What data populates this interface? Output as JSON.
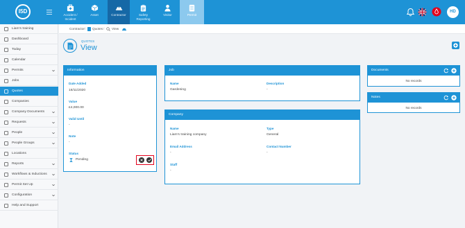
{
  "topbar": {
    "logo_text": "I5D",
    "nav": [
      {
        "label1": "Accident /",
        "label2": "Incident",
        "icon": "first-aid-icon"
      },
      {
        "label1": "Asset",
        "label2": "",
        "icon": "asset-box-icon"
      },
      {
        "label1": "Contractor",
        "label2": "",
        "icon": "hard-hat-icon"
      },
      {
        "label1": "Safety",
        "label2": "Reporting",
        "icon": "clipboard-icon"
      },
      {
        "label1": "Visitor",
        "label2": "",
        "icon": "person-icon"
      },
      {
        "label1": "Permit",
        "label2": "",
        "icon": "permit-icon"
      }
    ],
    "avatar_initials": "HD"
  },
  "sidebar": {
    "items": [
      {
        "label": "Liam's training",
        "icon": "swap-icon"
      },
      {
        "label": "Dashboard",
        "icon": "dashboard-icon"
      },
      {
        "label": "Today",
        "icon": "calendar-today-icon"
      },
      {
        "label": "Calendar",
        "icon": "calendar-icon"
      },
      {
        "label": "Permits",
        "icon": "folder-icon",
        "chevron": true
      },
      {
        "label": "Jobs",
        "icon": "document-icon"
      },
      {
        "label": "Quotes",
        "icon": "document-icon"
      },
      {
        "label": "Companies",
        "icon": "building-icon"
      },
      {
        "label": "Company Documents",
        "icon": "documents-icon",
        "chevron": true
      },
      {
        "label": "Requests",
        "icon": "inbox-icon",
        "chevron": true
      },
      {
        "label": "People",
        "icon": "people-icon",
        "chevron": true
      },
      {
        "label": "People Groups",
        "icon": "people-group-icon",
        "chevron": true
      },
      {
        "label": "Locations",
        "icon": "location-icon"
      },
      {
        "label": "Reports",
        "icon": "reports-icon",
        "chevron": true
      },
      {
        "label": "Workflows & Inductions",
        "icon": "workflow-icon",
        "chevron": true
      },
      {
        "label": "Permit Set Up",
        "icon": "setup-icon",
        "chevron": true
      },
      {
        "label": "Configuration",
        "icon": "gear-icon",
        "chevron": true
      },
      {
        "label": "Help and Support",
        "icon": "help-icon"
      }
    ],
    "active_index": 6
  },
  "breadcrumb": {
    "items": [
      "Contractor",
      "Quotes",
      "View"
    ]
  },
  "page": {
    "subtitle": "QUOTES",
    "title": "View"
  },
  "information": {
    "header": "Information",
    "date_added_label": "Date Added",
    "date_added_value": "16/11/2020",
    "value_label": "Value",
    "value_value": "£4,000.00",
    "valid_until_label": "Valid Until",
    "valid_until_value": "-",
    "note_label": "Note",
    "note_value": "-",
    "status_label": "Status",
    "status_value": "Pending"
  },
  "job": {
    "header": "Job",
    "name_label": "Name",
    "name_value": "Gardening",
    "description_label": "Description",
    "description_value": "-"
  },
  "company": {
    "header": "Company",
    "name_label": "Name",
    "name_value": "Liam's training company",
    "type_label": "Type",
    "type_value": "General",
    "email_label": "Email Address",
    "email_value": "-",
    "contact_label": "Contact Number",
    "contact_value": "-",
    "staff_label": "Staff",
    "staff_value": "-"
  },
  "documents": {
    "header": "Documents",
    "empty": "No records"
  },
  "notes": {
    "header": "Notes",
    "empty": "No records"
  },
  "colors": {
    "primary": "#1e93d6",
    "dark_nav": "#1668a6",
    "highlight": "#e3001b"
  }
}
